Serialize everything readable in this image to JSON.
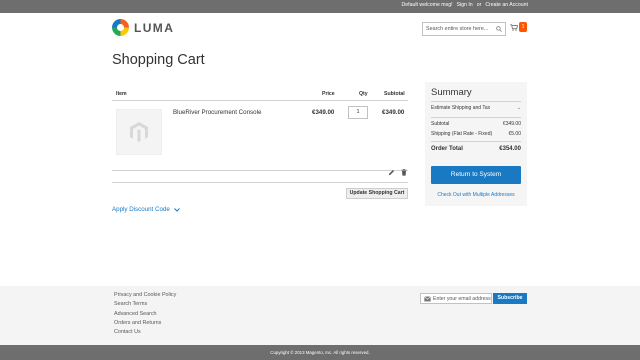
{
  "topbar": {
    "welcome": "Default welcome msg!",
    "sign_in": "Sign In",
    "or": "or",
    "create_account": "Create an Account"
  },
  "header": {
    "logo_text": "LUMA",
    "search_placeholder": "Search entire store here...",
    "cart_count": "1"
  },
  "page": {
    "title": "Shopping Cart"
  },
  "cart": {
    "columns": {
      "item": "Item",
      "price": "Price",
      "qty": "Qty",
      "subtotal": "Subtotal"
    },
    "items": [
      {
        "name": "BlueRiver Procurement Console",
        "price": "€349.00",
        "qty": "1",
        "subtotal": "€349.00"
      }
    ],
    "update_label": "Update Shopping Cart",
    "discount_label": "Apply Discount Code"
  },
  "summary": {
    "title": "Summary",
    "estimate_label": "Estimate Shipping and Tax",
    "subtotal_label": "Subtotal",
    "subtotal_value": "€349.00",
    "shipping_label": "Shipping (Flat Rate - Fixed)",
    "shipping_value": "€5.00",
    "total_label": "Order Total",
    "total_value": "€354.00",
    "primary_button": "Return to System",
    "multi_link": "Check Out with Multiple Addresses"
  },
  "footer": {
    "links": [
      "Privacy and Cookie Policy",
      "Search Terms",
      "Advanced Search",
      "Orders and Returns",
      "Contact Us"
    ],
    "newsletter_placeholder": "Enter your email address",
    "subscribe_label": "Subscribe",
    "copyright": "Copyright © 2013 Magento, Inc. All rights reserved."
  },
  "colors": {
    "accent": "#1979c3",
    "badge": "#ff5501",
    "bar": "#6e6e6e"
  }
}
